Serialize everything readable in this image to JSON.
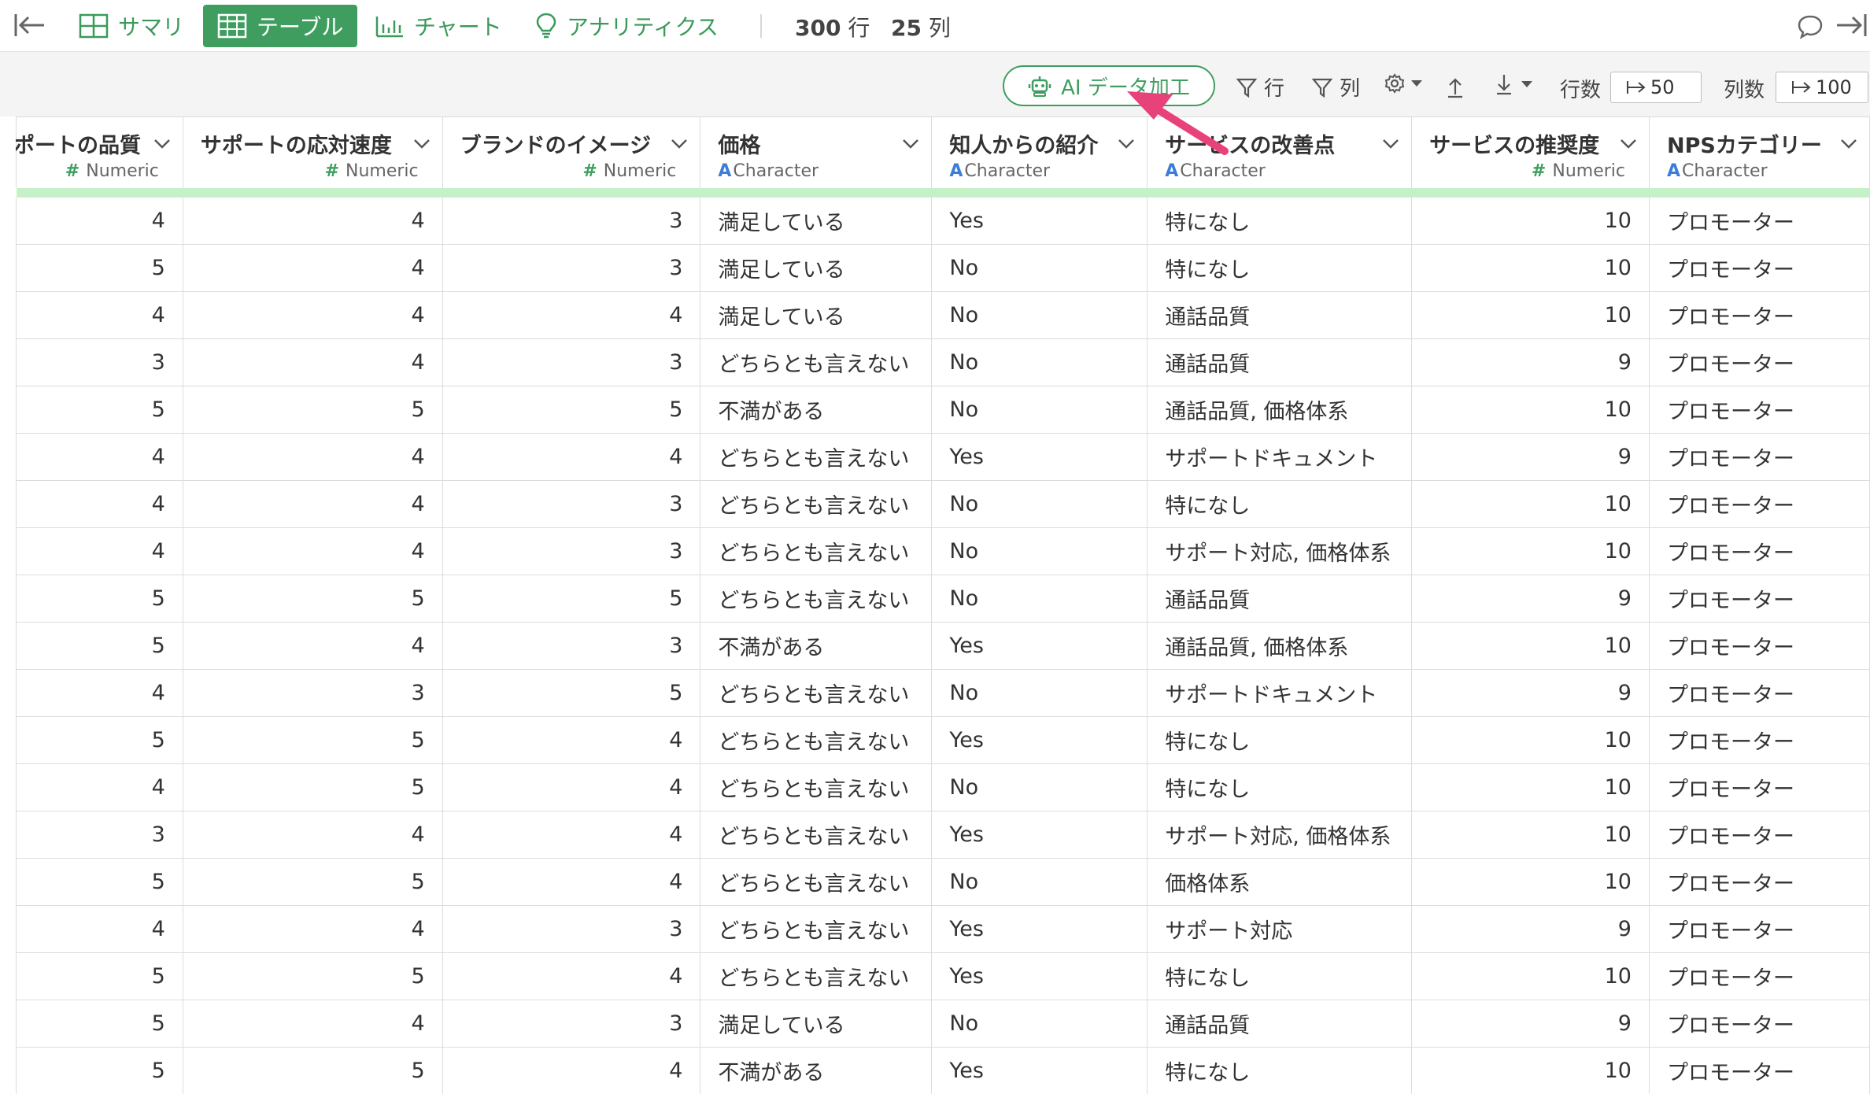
{
  "topnav": {
    "tabs": [
      {
        "label": "サマリ",
        "icon": "summary-grid-icon",
        "active": false
      },
      {
        "label": "テーブル",
        "icon": "table-icon",
        "active": true
      },
      {
        "label": "チャート",
        "icon": "bar-chart-icon",
        "active": false
      },
      {
        "label": "アナリティクス",
        "icon": "lightbulb-icon",
        "active": false
      }
    ],
    "rows_count": "300",
    "rows_unit": "行",
    "cols_count": "25",
    "cols_unit": "列"
  },
  "toolbar": {
    "ai_button": "AI データ加工",
    "filter_rows": "行",
    "filter_cols": "列",
    "row_count_label": "行数",
    "row_count_value": "50",
    "col_count_label": "列数",
    "col_count_value": "100"
  },
  "colors": {
    "accent": "#3f9e5f",
    "numeric_type": "#3f9e5f",
    "character_type": "#3b7dd8",
    "header_bar": "#c6f1c8",
    "annotation_arrow": "#e8427a"
  },
  "table": {
    "columns": [
      {
        "title": "ポートの品質",
        "type": "Numeric",
        "kind": "num"
      },
      {
        "title": "サポートの応対速度",
        "type": "Numeric",
        "kind": "num"
      },
      {
        "title": "ブランドのイメージ",
        "type": "Numeric",
        "kind": "num"
      },
      {
        "title": "価格",
        "type": "Character",
        "kind": "chr"
      },
      {
        "title": "知人からの紹介",
        "type": "Character",
        "kind": "chr"
      },
      {
        "title": "サービスの改善点",
        "type": "Character",
        "kind": "chr"
      },
      {
        "title": "サービスの推奨度",
        "type": "Numeric",
        "kind": "num"
      },
      {
        "title": "NPSカテゴリー",
        "type": "Character",
        "kind": "chr"
      }
    ],
    "rows": [
      [
        "4",
        "4",
        "3",
        "満足している",
        "Yes",
        "特になし",
        "10",
        "プロモーター"
      ],
      [
        "5",
        "4",
        "3",
        "満足している",
        "No",
        "特になし",
        "10",
        "プロモーター"
      ],
      [
        "4",
        "4",
        "4",
        "満足している",
        "No",
        "通話品質",
        "10",
        "プロモーター"
      ],
      [
        "3",
        "4",
        "3",
        "どちらとも言えない",
        "No",
        "通話品質",
        "9",
        "プロモーター"
      ],
      [
        "5",
        "5",
        "5",
        "不満がある",
        "No",
        "通話品質, 価格体系",
        "10",
        "プロモーター"
      ],
      [
        "4",
        "4",
        "4",
        "どちらとも言えない",
        "Yes",
        "サポートドキュメント",
        "9",
        "プロモーター"
      ],
      [
        "4",
        "4",
        "3",
        "どちらとも言えない",
        "No",
        "特になし",
        "10",
        "プロモーター"
      ],
      [
        "4",
        "4",
        "3",
        "どちらとも言えない",
        "No",
        "サポート対応, 価格体系",
        "10",
        "プロモーター"
      ],
      [
        "5",
        "5",
        "5",
        "どちらとも言えない",
        "No",
        "通話品質",
        "9",
        "プロモーター"
      ],
      [
        "5",
        "4",
        "3",
        "不満がある",
        "Yes",
        "通話品質, 価格体系",
        "10",
        "プロモーター"
      ],
      [
        "4",
        "3",
        "5",
        "どちらとも言えない",
        "No",
        "サポートドキュメント",
        "9",
        "プロモーター"
      ],
      [
        "5",
        "5",
        "4",
        "どちらとも言えない",
        "Yes",
        "特になし",
        "10",
        "プロモーター"
      ],
      [
        "4",
        "5",
        "4",
        "どちらとも言えない",
        "No",
        "特になし",
        "10",
        "プロモーター"
      ],
      [
        "3",
        "4",
        "4",
        "どちらとも言えない",
        "Yes",
        "サポート対応, 価格体系",
        "10",
        "プロモーター"
      ],
      [
        "5",
        "5",
        "4",
        "どちらとも言えない",
        "No",
        "価格体系",
        "10",
        "プロモーター"
      ],
      [
        "4",
        "4",
        "3",
        "どちらとも言えない",
        "Yes",
        "サポート対応",
        "9",
        "プロモーター"
      ],
      [
        "5",
        "5",
        "4",
        "どちらとも言えない",
        "Yes",
        "特になし",
        "10",
        "プロモーター"
      ],
      [
        "5",
        "4",
        "3",
        "満足している",
        "No",
        "通話品質",
        "9",
        "プロモーター"
      ],
      [
        "5",
        "5",
        "4",
        "不満がある",
        "Yes",
        "特になし",
        "10",
        "プロモーター"
      ]
    ]
  }
}
